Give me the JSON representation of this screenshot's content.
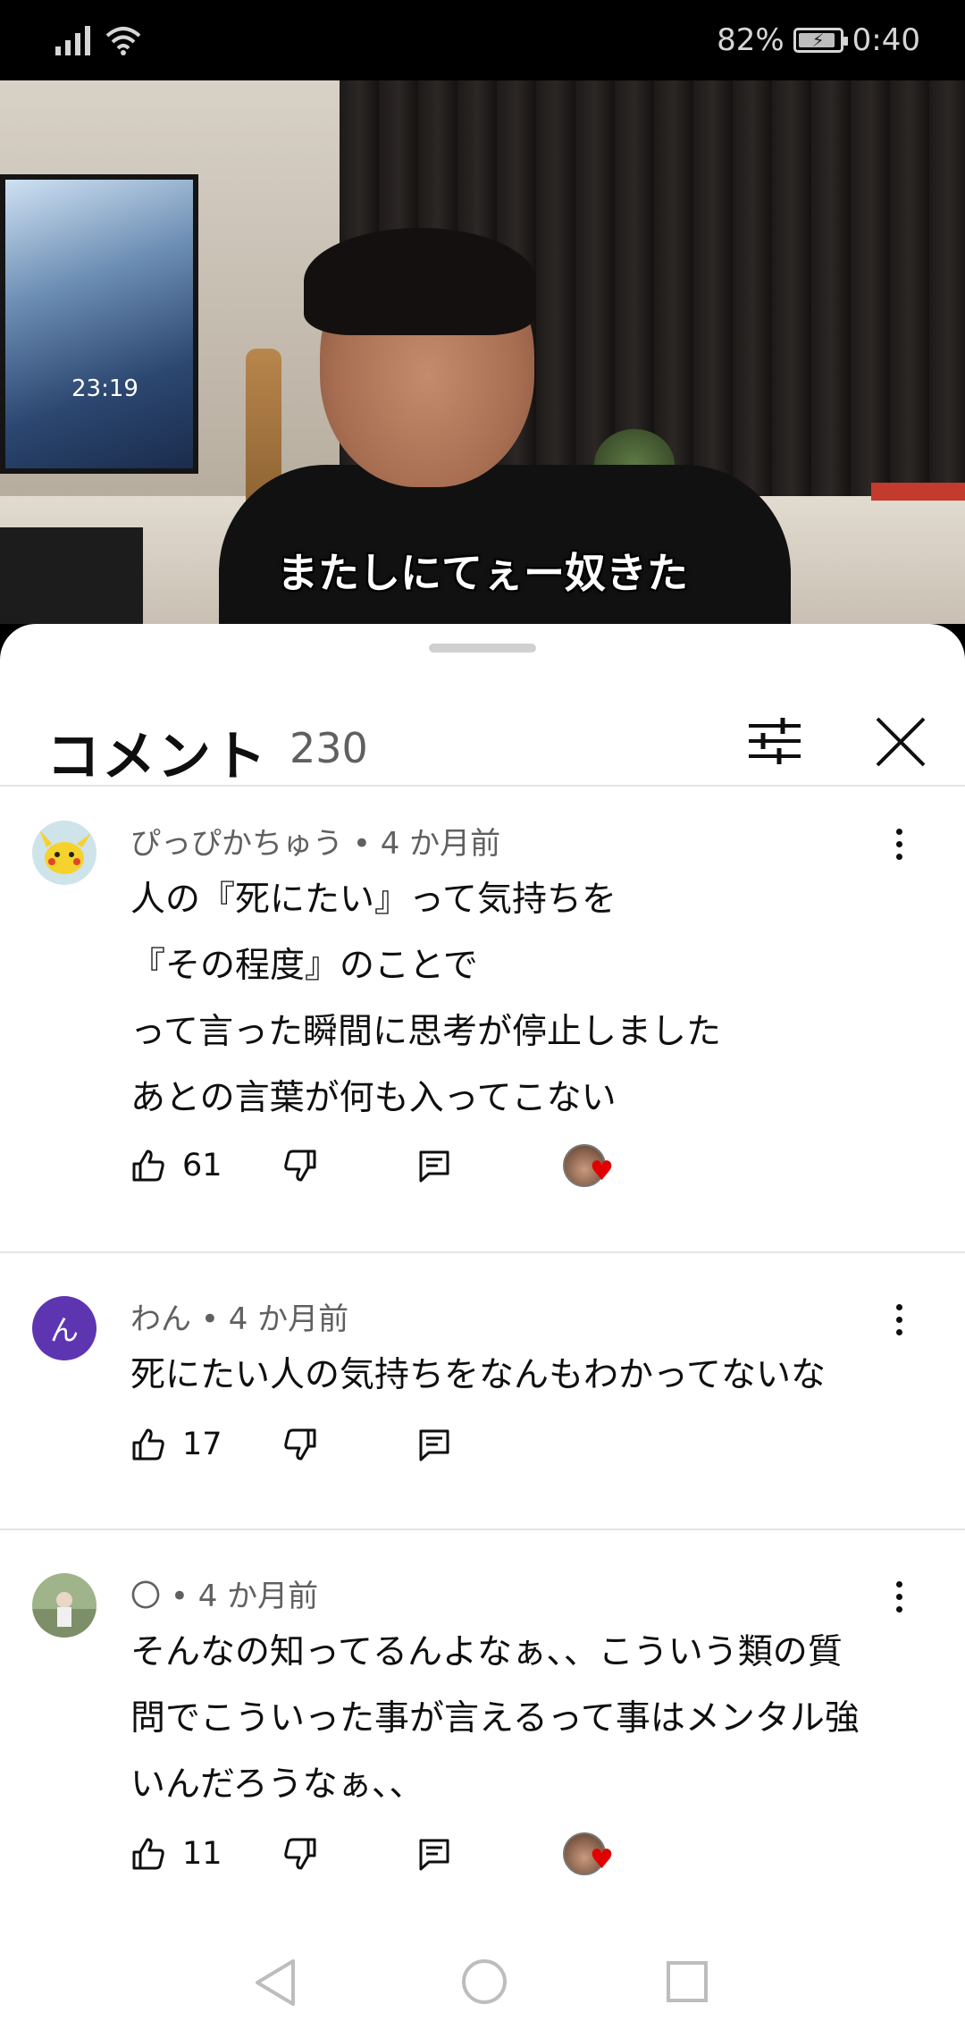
{
  "status_bar": {
    "battery": "82%",
    "time": "0:40"
  },
  "video": {
    "subtitle": "またしにてぇー奴きた",
    "tv_clock": "23:19",
    "progress_fraction": 0.05
  },
  "comments_header": {
    "title": "コメント",
    "count": "230"
  },
  "comments": [
    {
      "author": "ぴっぴかちゅう",
      "time": "4 か月前",
      "lines": [
        "人の『死にたい』って気持ちを",
        "『その程度』のことで",
        "って言った瞬間に思考が停止しました",
        "あとの言葉が何も入ってこない"
      ],
      "likes": "61",
      "creator_heart": true,
      "avatar_letter": ""
    },
    {
      "author": "わん",
      "time": "4 か月前",
      "lines": [
        "死にたい人の気持ちをなんもわかってないな"
      ],
      "likes": "17",
      "creator_heart": false,
      "avatar_letter": "ん"
    },
    {
      "author": "〇",
      "time": "4 か月前",
      "lines": [
        "そんなの知ってるんよなぁ、、こういう類の質",
        "問でこういった事が言えるって事はメンタル強",
        "いんだろうなぁ、、"
      ],
      "likes": "11",
      "creator_heart": true,
      "avatar_letter": ""
    }
  ],
  "colors": {
    "accent_red": "#ff0000",
    "heart_red": "#e10000",
    "avatar_purple": "#5e35b1"
  }
}
